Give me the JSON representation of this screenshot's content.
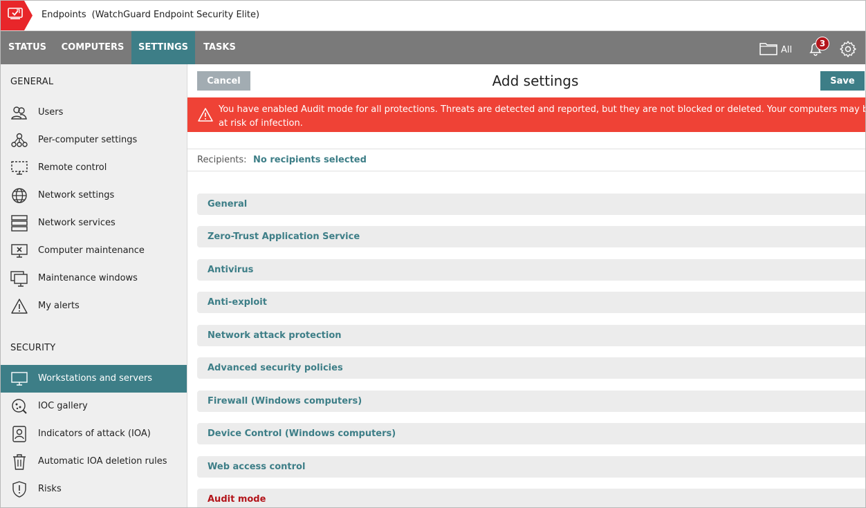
{
  "app": {
    "title": "Endpoints",
    "product": "(WatchGuard Endpoint Security Elite)"
  },
  "nav": {
    "tabs": [
      {
        "label": "STATUS"
      },
      {
        "label": "COMPUTERS"
      },
      {
        "label": "SETTINGS",
        "active": true
      },
      {
        "label": "TASKS"
      }
    ],
    "folder_label": "All",
    "notifications_count": "3"
  },
  "sidebar": {
    "general_title": "GENERAL",
    "general_items": [
      {
        "label": "Users",
        "icon": "users-icon"
      },
      {
        "label": "Per-computer settings",
        "icon": "network-nodes-icon"
      },
      {
        "label": "Remote control",
        "icon": "remote-monitor-icon"
      },
      {
        "label": "Network settings",
        "icon": "globe-icon"
      },
      {
        "label": "Network services",
        "icon": "server-icon"
      },
      {
        "label": "Computer maintenance",
        "icon": "monitor-x-icon"
      },
      {
        "label": "Maintenance windows",
        "icon": "monitors-icon"
      },
      {
        "label": "My alerts",
        "icon": "warning-icon"
      }
    ],
    "security_title": "SECURITY",
    "security_items": [
      {
        "label": "Workstations and servers",
        "icon": "monitor-icon",
        "active": true
      },
      {
        "label": "IOC gallery",
        "icon": "ioc-icon"
      },
      {
        "label": "Indicators of attack (IOA)",
        "icon": "ioa-icon"
      },
      {
        "label": "Automatic IOA deletion rules",
        "icon": "trash-icon"
      },
      {
        "label": "Risks",
        "icon": "shield-icon"
      }
    ]
  },
  "main": {
    "cancel_label": "Cancel",
    "page_title": "Add settings",
    "save_label": "Save",
    "alert_text": "You have enabled Audit mode for all protections. Threats are detected and reported, but they are not blocked or deleted. Your computers may be at risk of infection.",
    "recipients_label": "Recipients:",
    "recipients_value": "No recipients selected",
    "sections": [
      "General",
      "Zero-Trust Application Service",
      "Antivirus",
      "Anti-exploit",
      "Network attack protection",
      "Advanced security policies",
      "Firewall (Windows computers)",
      "Device Control (Windows computers)",
      "Web access control",
      "Audit mode"
    ]
  },
  "colors": {
    "brand_red": "#e8262a",
    "teal": "#3d7e87",
    "nav_gray": "#7a7a7a",
    "alert_red": "#ef4236",
    "audit_red": "#b3151b"
  }
}
